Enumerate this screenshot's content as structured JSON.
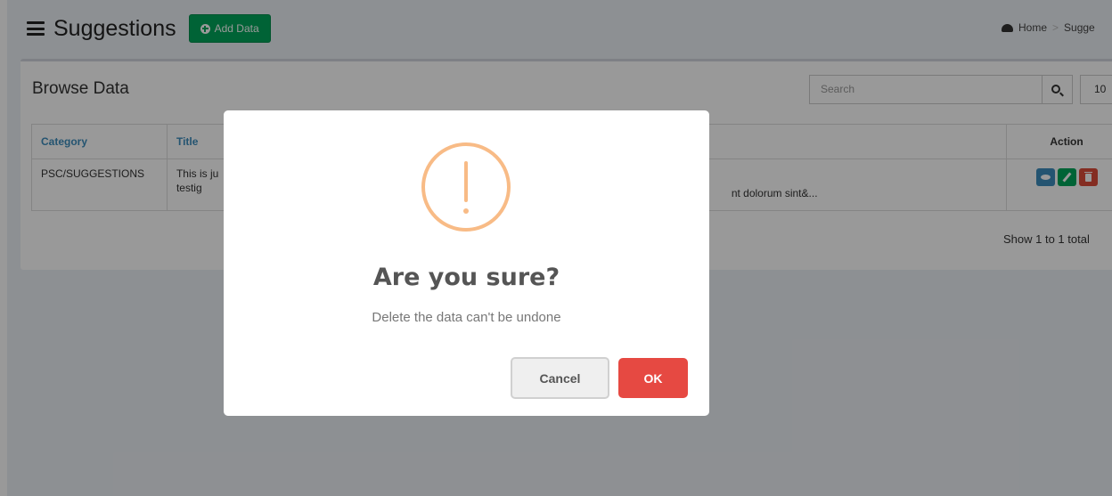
{
  "header": {
    "title": "Suggestions",
    "add_button": "Add Data",
    "breadcrumb": {
      "home": "Home",
      "separator": ">",
      "current": "Sugge"
    }
  },
  "box": {
    "title": "Browse Data",
    "search_placeholder": "Search",
    "page_size": "10",
    "columns": {
      "category": "Category",
      "title": "Title",
      "action": "Action"
    },
    "rows": [
      {
        "category": "PSC/SUGGESTIONS",
        "title_line1": "This is ju",
        "title_line2": "testig",
        "description": "nt dolorum sint&..."
      }
    ],
    "show_info": "Show 1 to 1 total"
  },
  "dialog": {
    "title": "Are you sure?",
    "text": "Delete the data can't be undone",
    "cancel": "Cancel",
    "ok": "OK"
  },
  "colors": {
    "add_button": "#00a65a",
    "view": "#3c8dbc",
    "edit": "#00a65a",
    "delete": "#dd4b39",
    "warning": "#f8bb86",
    "ok_button": "#e64942"
  }
}
